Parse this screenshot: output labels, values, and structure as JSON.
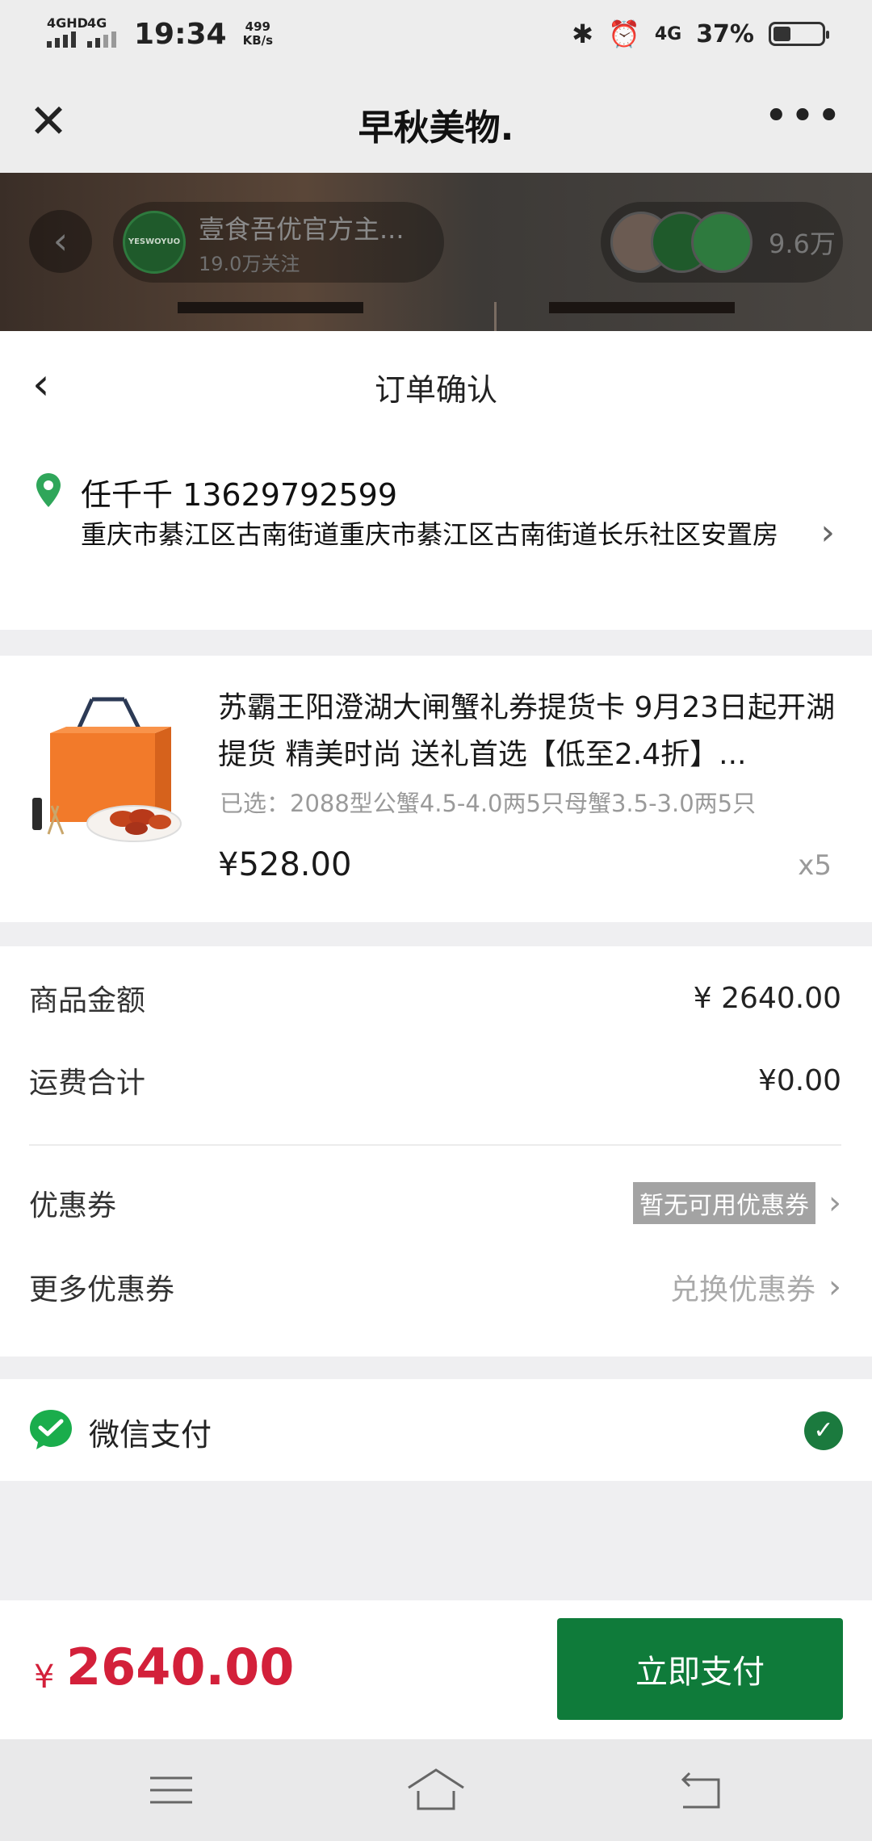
{
  "status_bar": {
    "network1": "4GHD",
    "network2": "4G",
    "time": "19:34",
    "speed_value": "499",
    "speed_unit": "KB/s",
    "net_right": "4G",
    "battery_percent": "37%",
    "battery_level": 0.37
  },
  "wechat_nav": {
    "title": "早秋美物."
  },
  "live": {
    "host_name": "壹食吾优官方主...",
    "host_fans": "19.0万关注",
    "host_logo_text": "YESWOYUO",
    "viewer_count": "9.6万"
  },
  "order": {
    "title": "订单确认",
    "address": {
      "name_phone": "任千千 13629792599",
      "detail": "重庆市綦江区古南街道重庆市綦江区古南街道长乐社区安置房"
    },
    "product": {
      "title": "苏霸王阳澄湖大闸蟹礼券提货卡 9月23日起开湖提货 精美时尚 送礼首选【低至2.4折】...",
      "spec": "已选：2088型公蟹4.5-4.0两5只母蟹3.5-3.0两5只",
      "price": "¥528.00",
      "qty": "x5"
    },
    "summary": {
      "goods_label": "商品金额",
      "goods_value": "¥ 2640.00",
      "shipping_label": "运费合计",
      "shipping_value": "¥0.00",
      "coupon_label": "优惠券",
      "coupon_value": "暂无可用优惠券",
      "more_coupon_label": "更多优惠券",
      "more_coupon_value": "兑换优惠券"
    },
    "payment": {
      "method": "微信支付"
    },
    "footer": {
      "currency": "¥",
      "total": "2640.00",
      "pay_button": "立即支付"
    }
  },
  "colors": {
    "accent_green": "#0f7b3a",
    "price_red": "#d3203a"
  }
}
